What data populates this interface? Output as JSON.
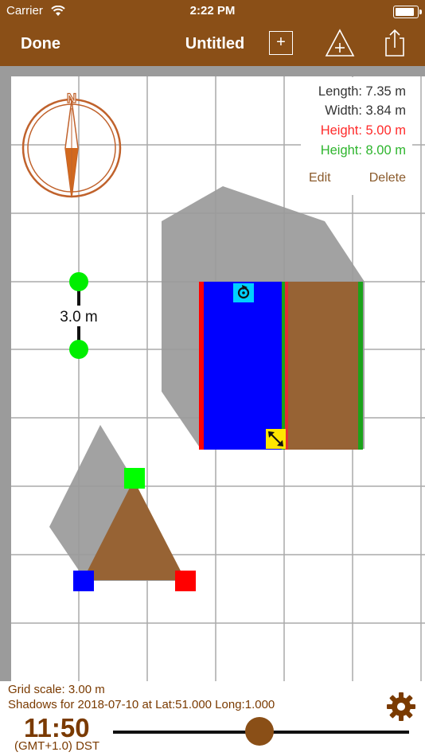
{
  "status_bar": {
    "carrier": "Carrier",
    "time": "2:22 PM",
    "battery_level": 0.9
  },
  "nav": {
    "done_label": "Done",
    "title": "Untitled",
    "add_symbol": "+"
  },
  "compass": {
    "north_label": "N"
  },
  "scale_marker": {
    "label": "3.0 m"
  },
  "info_panel": {
    "length": "Length: 7.35 m",
    "width": "Width: 3.84 m",
    "height_red": "Height: 5.00 m",
    "height_green": "Height: 8.00 m",
    "edit_label": "Edit",
    "delete_label": "Delete"
  },
  "bottom": {
    "grid_scale": "Grid scale: 3.00 m",
    "shadows": "Shadows for 2018-07-10 at Lat:51.000 Long:1.000",
    "time": "11:50",
    "timezone": "(GMT+1.0) DST",
    "slider_value": 0.495
  },
  "colors": {
    "bar": "#8a4f17",
    "shadow": "#9a9a9a",
    "roof_brown": "#976334",
    "wall_blue": "#0000ff",
    "red": "#ff0000",
    "green": "#00ff00",
    "dark_green": "#1aa31a",
    "rotate_cyan": "#00d0ff",
    "resize_yellow": "#ffe600",
    "height_red_text": "#ff2a2a",
    "height_green_text": "#2db52d",
    "label_brown": "#8a5a2b"
  },
  "icons": [
    "wifi-icon",
    "battery-icon",
    "add-shape-icon",
    "add-triangle-icon",
    "share-icon",
    "compass-icon",
    "rotate-icon",
    "resize-icon",
    "gear-icon"
  ]
}
